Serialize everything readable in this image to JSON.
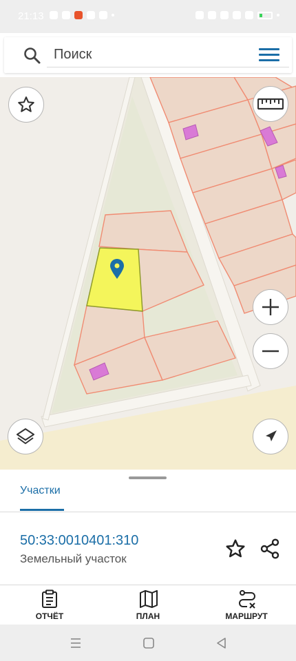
{
  "status_bar": {
    "time": "21:13",
    "icons": [
      "whatsapp-icon",
      "cloud-icon",
      "wps-icon",
      "location-icon",
      "card-icon",
      "dot-icon",
      "vibrate-icon",
      "bluetooth-icon",
      "location-icon",
      "volte-icon",
      "signal-icon",
      "battery-icon",
      "charging-icon"
    ]
  },
  "search": {
    "placeholder": "Поиск"
  },
  "map": {
    "controls": [
      "favorite-star-icon",
      "ruler-icon",
      "zoom-in-icon",
      "zoom-out-icon",
      "layers-icon",
      "navigation-arrow-icon"
    ],
    "colors": {
      "background": "#f1eee9",
      "parcel_fill": "#edd7c8",
      "parcel_stroke": "#f08b72",
      "selected_parcel": "#f4f55b",
      "building": "#d97ad6",
      "pin": "#1b6ea7",
      "beach": "#f5edcf"
    }
  },
  "panel": {
    "tab": "Участки",
    "parcel": {
      "cadastral_number": "50:33:0010401:310",
      "type": "Земельный участок"
    }
  },
  "bottom_nav": [
    {
      "label": "ОТЧЁТ",
      "icon": "clipboard-icon"
    },
    {
      "label": "ПЛАН",
      "icon": "map-plan-icon"
    },
    {
      "label": "МАРШРУТ",
      "icon": "route-icon"
    }
  ],
  "system_nav": [
    "menu-icon",
    "home-icon",
    "back-icon"
  ],
  "theme": {
    "accent": "#1b6ea7"
  }
}
